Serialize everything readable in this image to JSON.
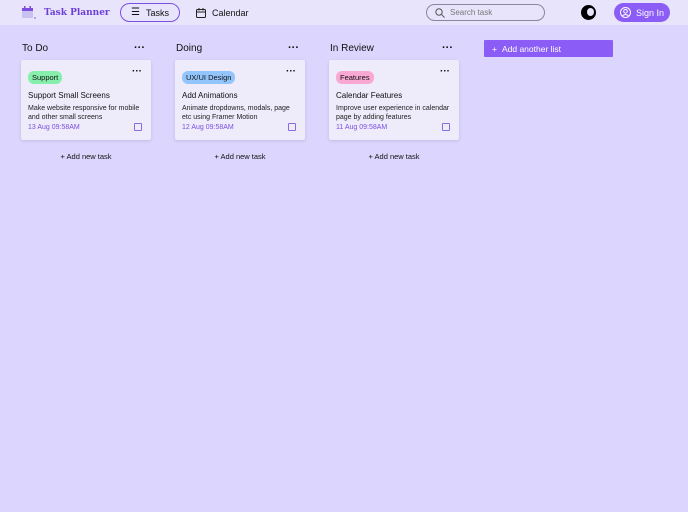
{
  "header": {
    "app_title": "Task Planner",
    "nav": [
      {
        "label": "Tasks",
        "icon": "list-checks-icon"
      },
      {
        "label": "Calendar",
        "icon": "calendar-icon"
      }
    ],
    "search_placeholder": "Search task",
    "sign_in": "Sign In"
  },
  "columns": [
    {
      "title": "To Do",
      "card": {
        "tag": "Support",
        "tag_color": "#86efac",
        "title": "Support Small Screens",
        "description": "Make website responsive for mobile and other small screens",
        "date": "13 Aug 09:58AM"
      },
      "add_label": "Add new task"
    },
    {
      "title": "Doing",
      "card": {
        "tag": "UX/UI Design",
        "tag_color": "#93c5fd",
        "title": "Add Animations",
        "description": "Animate dropdowns, modals, page etc using Framer Motion",
        "date": "12 Aug 09:58AM"
      },
      "add_label": "Add new task"
    },
    {
      "title": "In Review",
      "card": {
        "tag": "Features",
        "tag_color": "#f9a8d4",
        "title": "Calendar Features",
        "description": "Improve user experience in calendar page by adding features",
        "date": "11 Aug 09:58AM"
      },
      "add_label": "Add new task"
    }
  ],
  "add_list_label": "Add another list"
}
